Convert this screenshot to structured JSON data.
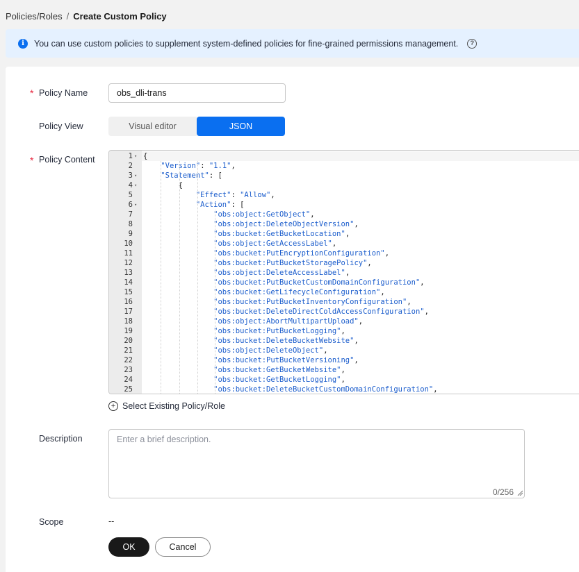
{
  "breadcrumb": {
    "parent": "Policies/Roles",
    "separator": "/",
    "current": "Create Custom Policy"
  },
  "banner": {
    "text": "You can use custom policies to supplement system-defined policies for fine-grained permissions management."
  },
  "form": {
    "required_mark": "*",
    "policy_name": {
      "label": "Policy Name",
      "value": "obs_dli-trans"
    },
    "policy_view": {
      "label": "Policy View",
      "options": [
        "Visual editor",
        "JSON"
      ],
      "selected": "JSON"
    },
    "policy_content": {
      "label": "Policy Content"
    },
    "select_existing": {
      "label": "Select Existing Policy/Role"
    },
    "description": {
      "label": "Description",
      "placeholder": "Enter a brief description.",
      "counter": "0/256"
    },
    "scope": {
      "label": "Scope",
      "value": "--"
    },
    "ok_label": "OK",
    "cancel_label": "Cancel"
  },
  "editor": {
    "fold_lines": [
      1,
      3,
      4,
      6
    ],
    "lines": [
      "{",
      "    \"Version\": \"1.1\",",
      "    \"Statement\": [",
      "        {",
      "            \"Effect\": \"Allow\",",
      "            \"Action\": [",
      "                \"obs:object:GetObject\",",
      "                \"obs:object:DeleteObjectVersion\",",
      "                \"obs:bucket:GetBucketLocation\",",
      "                \"obs:object:GetAccessLabel\",",
      "                \"obs:bucket:PutEncryptionConfiguration\",",
      "                \"obs:bucket:PutBucketStoragePolicy\",",
      "                \"obs:object:DeleteAccessLabel\",",
      "                \"obs:bucket:PutBucketCustomDomainConfiguration\",",
      "                \"obs:bucket:GetLifecycleConfiguration\",",
      "                \"obs:bucket:PutBucketInventoryConfiguration\",",
      "                \"obs:bucket:DeleteDirectColdAccessConfiguration\",",
      "                \"obs:object:AbortMultipartUpload\",",
      "                \"obs:bucket:PutBucketLogging\",",
      "                \"obs:bucket:DeleteBucketWebsite\",",
      "                \"obs:object:DeleteObject\",",
      "                \"obs:bucket:PutBucketVersioning\",",
      "                \"obs:bucket:GetBucketWebsite\",",
      "                \"obs:bucket:GetBucketLogging\",",
      "                \"obs:bucket:DeleteBucketCustomDomainConfiguration\","
    ]
  }
}
